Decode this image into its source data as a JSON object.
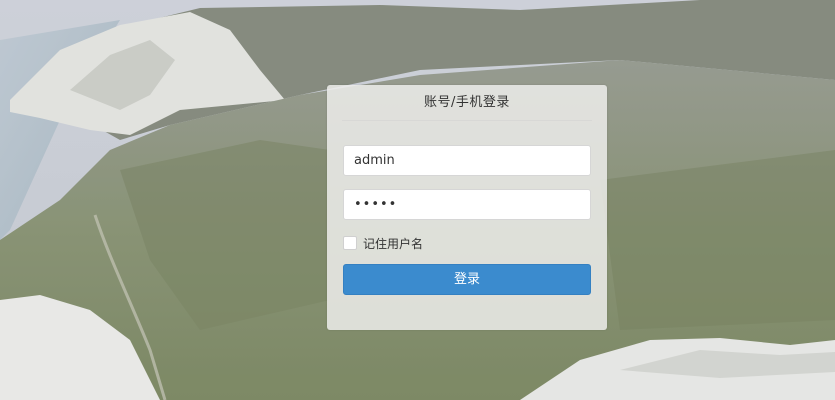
{
  "login": {
    "title": "账号/手机登录",
    "username_value": "admin",
    "password_value": "•••••",
    "remember_label": "记住用户名",
    "remember_checked": false,
    "submit_label": "登录"
  },
  "colors": {
    "accent": "#3b8bce",
    "panel_bg": "#ecebea",
    "text": "#333333"
  },
  "background": {
    "description_icon": "coastal-cliffs-background"
  }
}
